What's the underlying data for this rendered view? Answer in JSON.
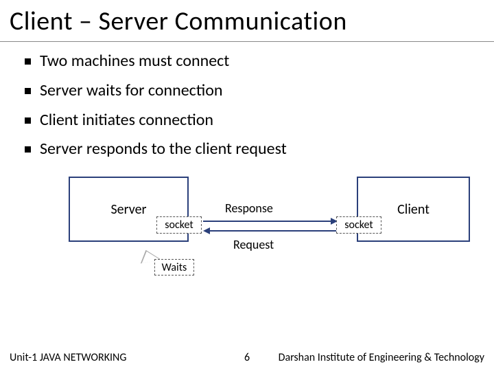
{
  "title": "Client – Server Communication",
  "bullets": [
    "Two machines must connect",
    "Server waits for connection",
    "Client initiates connection",
    "Server responds to the client request"
  ],
  "diagram": {
    "server_label": "Server",
    "client_label": "Client",
    "socket_label": "socket",
    "response_label": "Response",
    "request_label": "Request",
    "waits_label": "Waits"
  },
  "footer": {
    "left": "Unit-1 JAVA NETWORKING",
    "page": "6",
    "right": "Darshan Institute of Engineering & Technology"
  }
}
